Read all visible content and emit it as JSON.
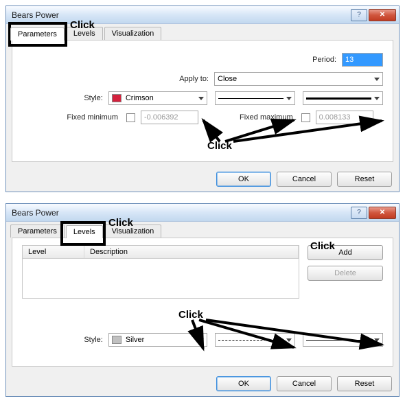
{
  "dialog1": {
    "title": "Bears Power",
    "tabs": {
      "parameters": "Parameters",
      "levels": "Levels",
      "visualization": "Visualization"
    },
    "period_label": "Period:",
    "period_value": "13",
    "applyto_label": "Apply to:",
    "applyto_value": "Close",
    "style_label": "Style:",
    "style_value": "Crimson",
    "fixmin_label": "Fixed minimum",
    "fixmin_value": "-0.006392",
    "fixmax_label": "Fixed maximum",
    "fixmax_value": "0.008133",
    "ok": "OK",
    "cancel": "Cancel",
    "reset": "Reset",
    "colors": {
      "crimson": "#d4213d",
      "silver": "#c0c0c0"
    }
  },
  "dialog2": {
    "title": "Bears Power",
    "tabs": {
      "parameters": "Parameters",
      "levels": "Levels",
      "visualization": "Visualization"
    },
    "col_level": "Level",
    "col_desc": "Description",
    "add": "Add",
    "delete": "Delete",
    "style_label": "Style:",
    "style_value": "Silver",
    "ok": "OK",
    "cancel": "Cancel",
    "reset": "Reset"
  },
  "annotations": {
    "click": "Click"
  }
}
